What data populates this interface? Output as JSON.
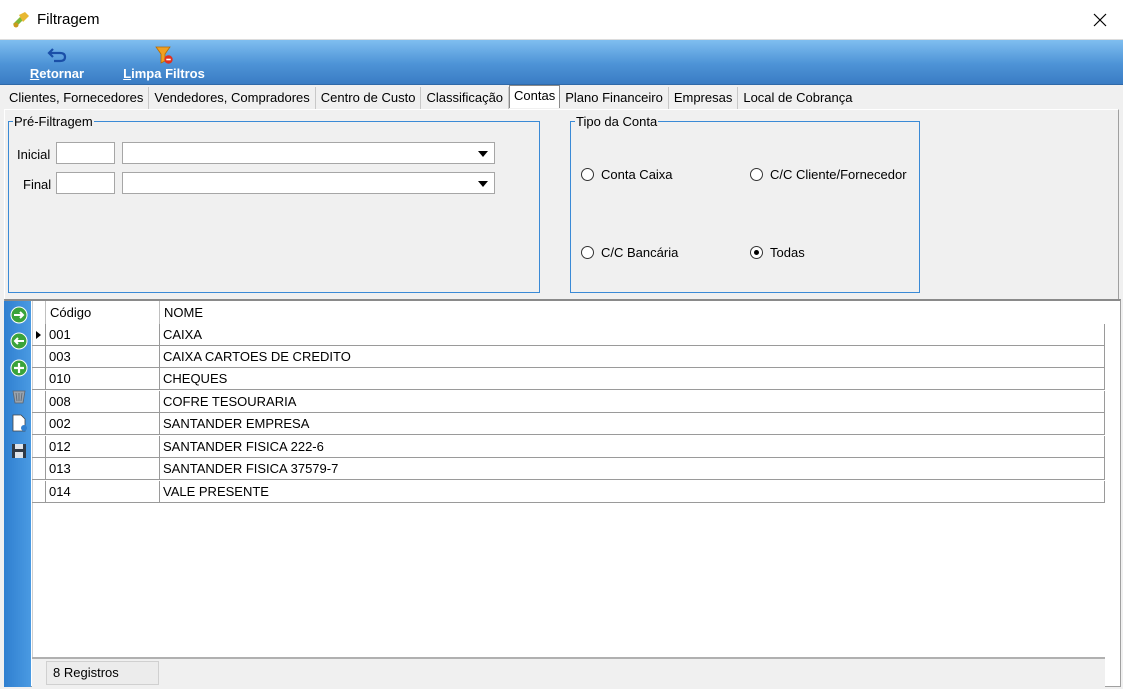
{
  "window": {
    "title": "Filtragem",
    "app_icon": "filter-app-icon",
    "close_icon": "close-icon"
  },
  "toolbar": {
    "retornar": {
      "mnemonic": "R",
      "rest": "etornar",
      "icon": "return-arrow-icon"
    },
    "limpa_filtros": {
      "mnemonic": "L",
      "rest": "impa Filtros",
      "icon": "clear-filter-icon"
    }
  },
  "tabs": [
    {
      "label": "Clientes, Fornecedores",
      "active": false
    },
    {
      "label": "Vendedores, Compradores",
      "active": false
    },
    {
      "label": "Centro de Custo",
      "active": false
    },
    {
      "label": "Classificação",
      "active": false
    },
    {
      "label": "Contas",
      "active": true
    },
    {
      "label": "Plano Financeiro",
      "active": false
    },
    {
      "label": "Empresas",
      "active": false
    },
    {
      "label": "Local de Cobrança",
      "active": false
    }
  ],
  "pre_filtragem": {
    "legend": "Pré-Filtragem",
    "inicial_label": "Inicial",
    "final_label": "Final",
    "inicial_code": "",
    "inicial_combo": "",
    "final_code": "",
    "final_combo": ""
  },
  "tipo_conta": {
    "legend": "Tipo da Conta",
    "options": [
      {
        "label": "Conta Caixa",
        "selected": false
      },
      {
        "label": "C/C Cliente/Fornecedor",
        "selected": false
      },
      {
        "label": "C/C Bancária",
        "selected": false
      },
      {
        "label": "Todas",
        "selected": true
      }
    ]
  },
  "side_buttons": [
    "next-arrow-icon",
    "prev-arrow-icon",
    "add-icon",
    "delete-bin-icon",
    "new-document-icon",
    "save-disk-icon"
  ],
  "grid": {
    "columns": [
      "Código",
      "NOME"
    ],
    "rows": [
      {
        "codigo": "001",
        "nome": "CAIXA",
        "current": true
      },
      {
        "codigo": "003",
        "nome": "CAIXA CARTOES DE CREDITO",
        "current": false
      },
      {
        "codigo": "010",
        "nome": "CHEQUES",
        "current": false
      },
      {
        "codigo": "008",
        "nome": "COFRE TESOURARIA",
        "current": false
      },
      {
        "codigo": "002",
        "nome": "SANTANDER EMPRESA",
        "current": false
      },
      {
        "codigo": "012",
        "nome": "SANTANDER FISICA 222-6",
        "current": false
      },
      {
        "codigo": "013",
        "nome": "SANTANDER FISICA 37579-7",
        "current": false
      },
      {
        "codigo": "014",
        "nome": "VALE PRESENTE",
        "current": false
      }
    ],
    "footer": "8 Registros"
  },
  "colors": {
    "toolbar_top": "#7fbef0",
    "toolbar_bottom": "#3a7cc4",
    "group_border": "#3a8ad6",
    "side_bar": "#2f7fd0"
  }
}
